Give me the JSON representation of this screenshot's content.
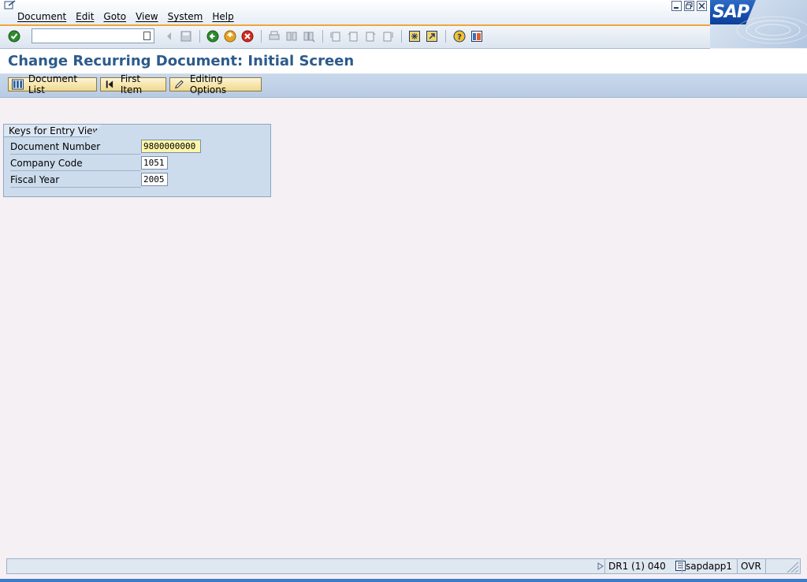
{
  "menu": {
    "items": [
      "Document",
      "Edit",
      "Goto",
      "View",
      "System",
      "Help"
    ]
  },
  "logo": {
    "text": "SAP"
  },
  "toolbar": {
    "command_field_value": "",
    "icons": [
      "enter-icon",
      "back-arrow-icon",
      "save-icon",
      "back-icon",
      "exit-icon",
      "cancel-icon",
      "print-icon",
      "find-icon",
      "find-next-icon",
      "first-page-icon",
      "previous-page-icon",
      "next-page-icon",
      "last-page-icon",
      "create-session-icon",
      "create-shortcut-icon",
      "help-icon",
      "layout-menu-icon"
    ]
  },
  "title": "Change Recurring Document: Initial Screen",
  "app_toolbar": {
    "document_list": "Document List",
    "first_item": "First Item",
    "editing_options": "Editing Options"
  },
  "group": {
    "title": "Keys for Entry View",
    "fields": [
      {
        "label": "Document Number",
        "value": "9800000000"
      },
      {
        "label": "Company Code",
        "value": "1051"
      },
      {
        "label": "Fiscal Year",
        "value": "2005"
      }
    ]
  },
  "status": {
    "system": "DR1 (1) 040",
    "server": "sapdapp1",
    "mode": "OVR"
  },
  "colors": {
    "title": "#2c5b8c",
    "button_bg": "#f0d98f",
    "required_field": "#fdf6a9",
    "accent_line": "#f0a53b"
  }
}
